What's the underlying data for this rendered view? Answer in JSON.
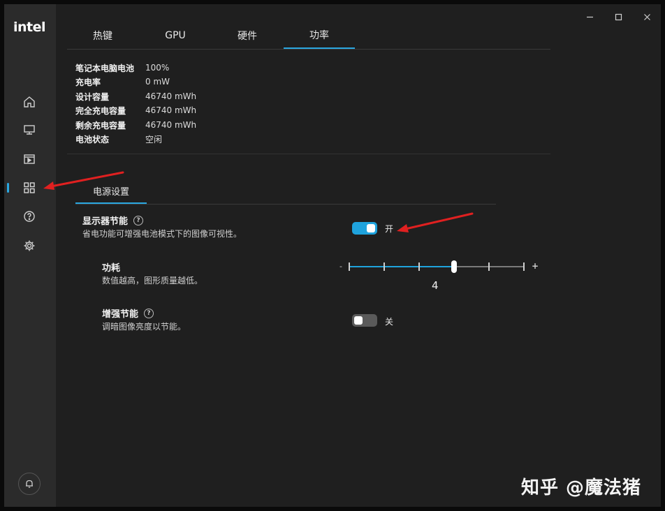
{
  "app": {
    "logo": "intel"
  },
  "sidebar": {
    "items": [
      {
        "name": "home-icon"
      },
      {
        "name": "monitor-icon"
      },
      {
        "name": "video-icon"
      },
      {
        "name": "grid-icon",
        "active": true
      },
      {
        "name": "help-icon"
      },
      {
        "name": "gear-icon"
      }
    ],
    "bottom": "bell-icon"
  },
  "window_controls": [
    "minimize",
    "maximize",
    "close"
  ],
  "tabs": [
    {
      "label": "热键"
    },
    {
      "label": "GPU"
    },
    {
      "label": "硬件"
    },
    {
      "label": "功率",
      "active": true
    }
  ],
  "battery_info": [
    {
      "label": "笔记本电脑电池",
      "value": "100%"
    },
    {
      "label": "充电率",
      "value": "0 mW"
    },
    {
      "label": "设计容量",
      "value": "46740 mWh"
    },
    {
      "label": "完全充电容量",
      "value": "46740 mWh"
    },
    {
      "label": "剩余充电容量",
      "value": "46740 mWh"
    },
    {
      "label": "电池状态",
      "value": "空闲"
    }
  ],
  "power_settings": {
    "section_label": "电源设置",
    "display_power_saving": {
      "title": "显示器节能",
      "description": "省电功能可增强电池模式下的图像可视性。",
      "state": "开",
      "on": true
    },
    "power_consumption": {
      "title": "功耗",
      "description": "数值越高，图形质量越低。",
      "min_symbol": "-",
      "max_symbol": "+",
      "value": "4",
      "position": 4,
      "steps": 6
    },
    "enhanced_saving": {
      "title": "增强节能",
      "description": "调暗图像亮度以节能。",
      "state": "关",
      "on": false
    }
  },
  "colors": {
    "accent": "#1fa3dd",
    "annotation_arrow": "#e02020"
  },
  "watermark": "知乎 @魔法猪"
}
